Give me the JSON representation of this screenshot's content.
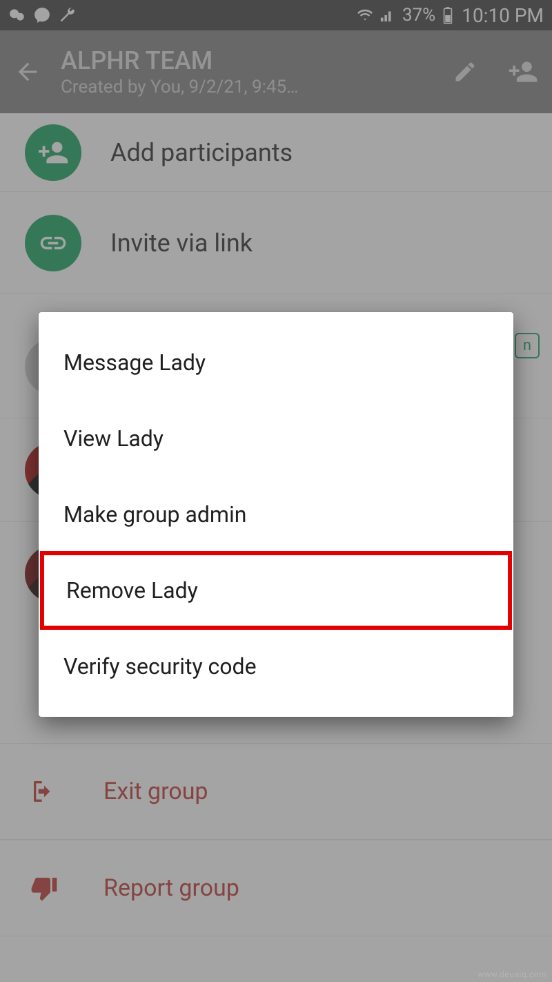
{
  "statusbar": {
    "battery_pct": "37%",
    "time": "10:10 PM"
  },
  "appbar": {
    "title": "ALPHR TEAM",
    "subtitle": "Created by You, 9/2/21, 9:45…"
  },
  "rows": {
    "add_participants": "Add participants",
    "invite_link": "Invite via link",
    "exit_group": "Exit group",
    "report_group": "Report group"
  },
  "admin_chip": "n",
  "menu": {
    "message": "Message Lady",
    "view": "View Lady",
    "make_admin": "Make group admin",
    "remove": "Remove Lady",
    "verify": "Verify security code"
  },
  "watermark": "www.deuaiq.com"
}
